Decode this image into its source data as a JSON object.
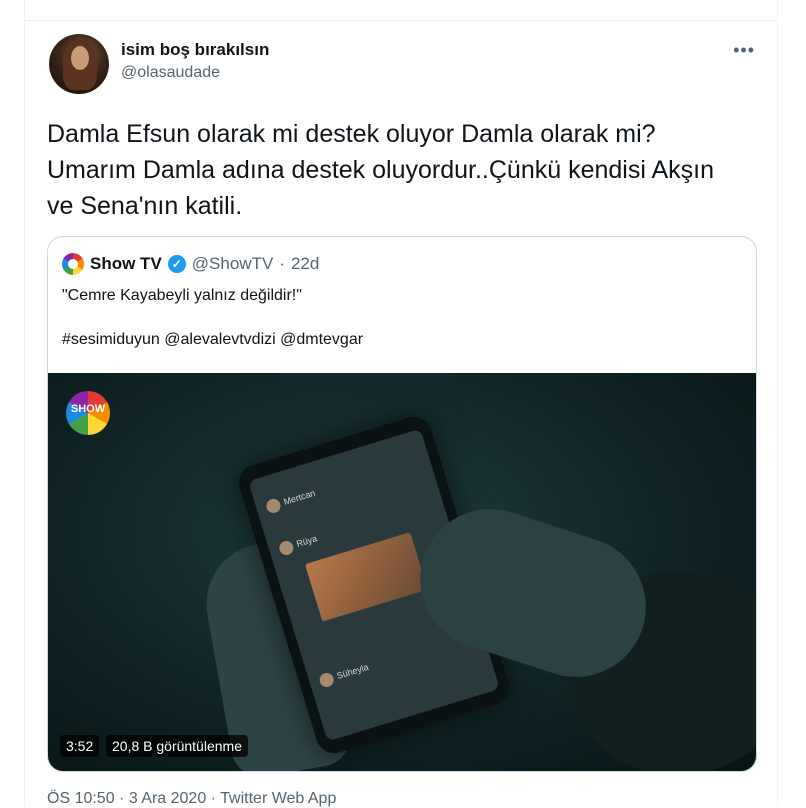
{
  "tweet": {
    "author_name": "isim boş bırakılsın",
    "author_handle": "@olasaudade",
    "more_icon": "more-icon",
    "text": "Damla Efsun olarak mi destek oluyor Damla olarak mi? Umarım Damla adına destek oluyordur..Çünkü kendisi Akşın ve Sena'nın katili.",
    "footer": "ÖS 10:50 · 3 Ara 2020 · Twitter Web App"
  },
  "quote": {
    "name": "Show TV",
    "handle": "@ShowTV",
    "sep": "·",
    "time": "22d",
    "line1": "\"Cemre Kayabeyli yalnız değildir!\"",
    "line2": "#sesimiduyun @alevalevtvdizi @dmtevgar",
    "video": {
      "logo_text": "SHOW",
      "duration": "3:52",
      "views": "20,8 B görüntülenme",
      "screen_names": [
        "Mertcan",
        "Rüya",
        "Süheyla"
      ]
    }
  },
  "colors": {
    "text": "#0f1419",
    "secondary": "#536471",
    "border": "#cfd9de",
    "verified": "#1d9bf0"
  }
}
